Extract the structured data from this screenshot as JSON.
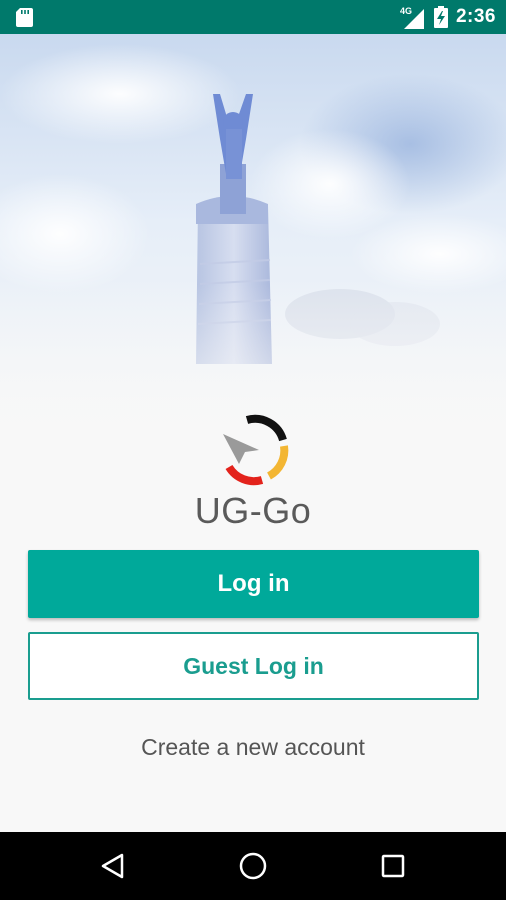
{
  "status_bar": {
    "network": "4G",
    "time": "2:36",
    "icons": [
      "sd-card-icon",
      "signal-icon",
      "battery-charging-icon"
    ]
  },
  "app": {
    "name": "UG-Go",
    "logo": "ug-go-logo"
  },
  "buttons": {
    "login_label": "Log in",
    "guest_label": "Guest Log in",
    "create_account_label": "Create a new account"
  },
  "nav_bar": {
    "icons": [
      "back-icon",
      "home-icon",
      "recents-icon"
    ]
  },
  "colors": {
    "status_bar": "#00796b",
    "primary": "#00a99a",
    "outline": "#1a9d8f",
    "text_muted": "#555555"
  }
}
